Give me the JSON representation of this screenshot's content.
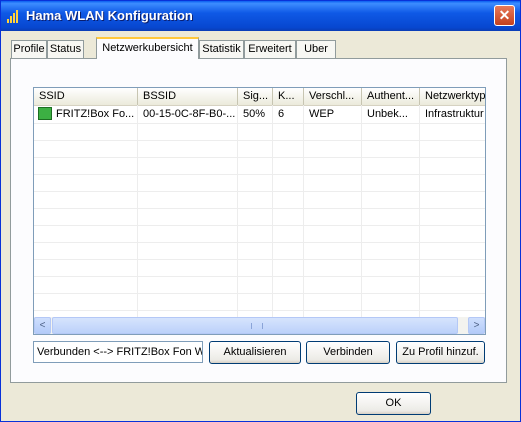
{
  "window": {
    "title": "Hama WLAN Konfiguration"
  },
  "tabs": [
    {
      "label": "Profile"
    },
    {
      "label": "Status"
    },
    {
      "label": "Netzwerkubersicht"
    },
    {
      "label": "Statistik"
    },
    {
      "label": "Erweitert"
    },
    {
      "label": "Uber"
    }
  ],
  "active_tab": "Netzwerkubersicht",
  "network_list": {
    "columns": [
      "SSID",
      "BSSID",
      "Sig...",
      "K...",
      "Verschl...",
      "Authent...",
      "Netzwerktyp"
    ],
    "rows": [
      {
        "ssid": "FRITZ!Box Fo...",
        "bssid": "00-15-0C-8F-B0-...",
        "signal": "50%",
        "channel": "6",
        "encryption": "WEP",
        "auth": "Unbek...",
        "type": "Infrastruktur",
        "icon": "wireless-network-icon"
      }
    ]
  },
  "scrollbar": {
    "left_arrow": "<",
    "right_arrow": ">"
  },
  "status_text": "Verbunden <--> FRITZ!Box Fon W",
  "buttons": {
    "refresh": "Aktualisieren",
    "connect": "Verbinden",
    "add_profile": "Zu Profil hinzuf.",
    "ok": "OK"
  },
  "colors": {
    "titlebar": "#0747d0",
    "active_tab_accent": "#ffc83c",
    "panel": "#ece9d8"
  }
}
